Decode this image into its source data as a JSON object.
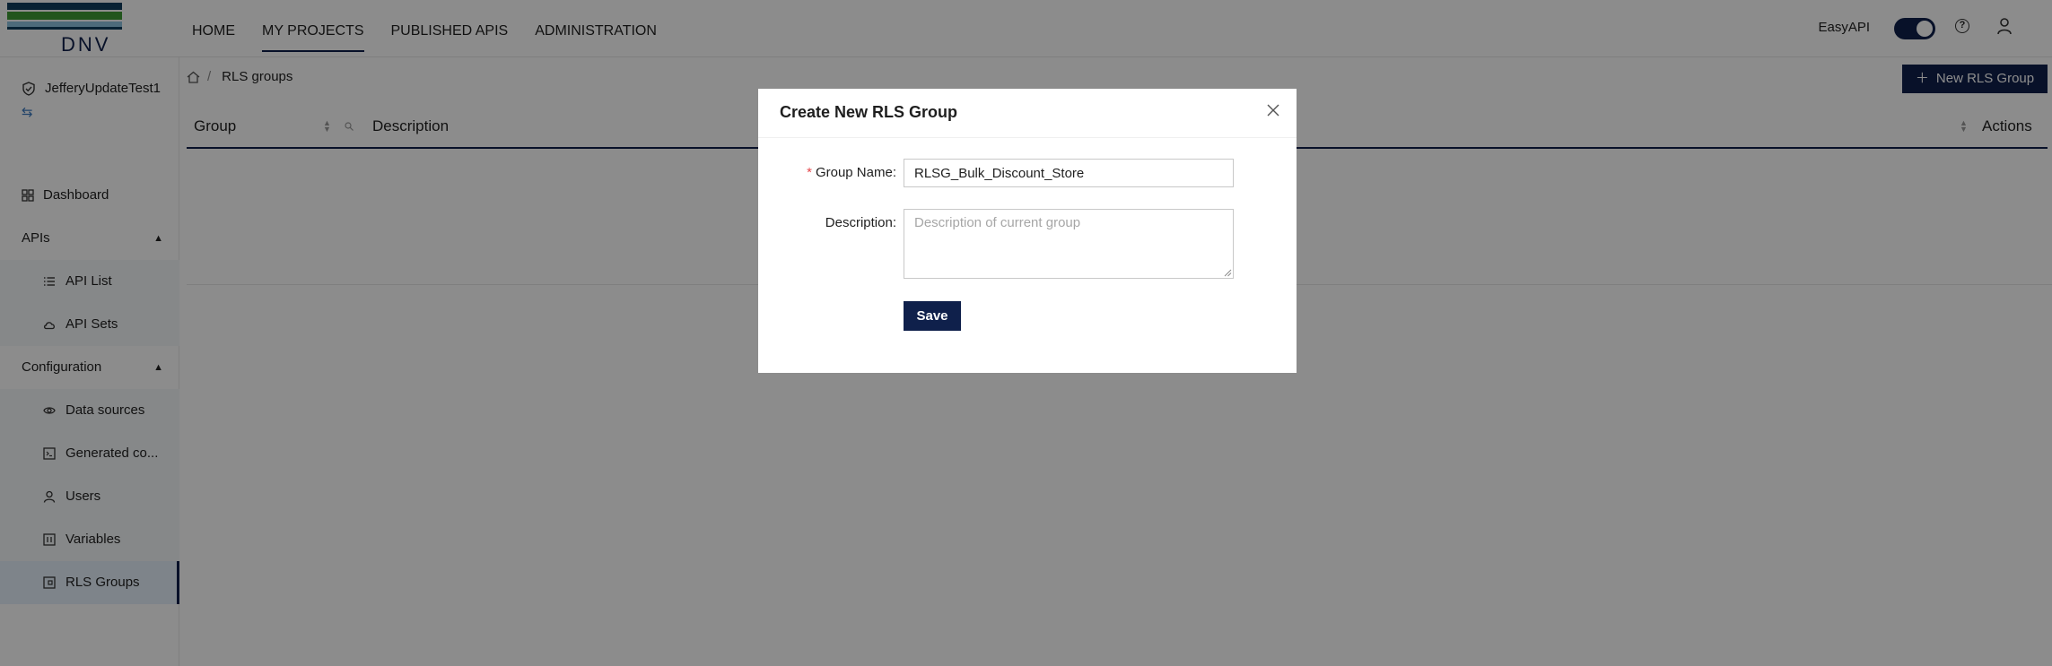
{
  "app": {
    "logo_text": "DNV",
    "brand_color": "#0f204b"
  },
  "nav": {
    "items": [
      {
        "label": "HOME",
        "active": false
      },
      {
        "label": "MY PROJECTS",
        "active": true
      },
      {
        "label": "PUBLISHED APIS",
        "active": false
      },
      {
        "label": "ADMINISTRATION",
        "active": false
      }
    ]
  },
  "topright": {
    "easyapi_label": "EasyAPI",
    "toggle_on": true,
    "help_icon": "question-circle-icon",
    "user_icon": "user-icon"
  },
  "sidebar": {
    "project_name": "JefferyUpdateTest1",
    "swap_icon": "swap-icon",
    "items": {
      "dashboard": "Dashboard",
      "apis": "APIs",
      "api_list": "API List",
      "api_sets": "API Sets",
      "configuration": "Configuration",
      "data_sources": "Data sources",
      "generated_code": "Generated co...",
      "users": "Users",
      "variables": "Variables",
      "rls_groups": "RLS Groups"
    }
  },
  "main": {
    "breadcrumb": {
      "sep": "/",
      "current": "RLS groups"
    },
    "new_button": "New RLS Group",
    "table": {
      "col_group": "Group",
      "col_description": "Description",
      "col_actions": "Actions"
    }
  },
  "modal": {
    "title": "Create New RLS Group",
    "group_name_label": "Group Name",
    "group_name_value": "RLSG_Bulk_Discount_Store",
    "description_label": "Description",
    "description_placeholder": "Description of current group",
    "save_label": "Save",
    "label_suffix": ":",
    "required_mark": "*"
  }
}
